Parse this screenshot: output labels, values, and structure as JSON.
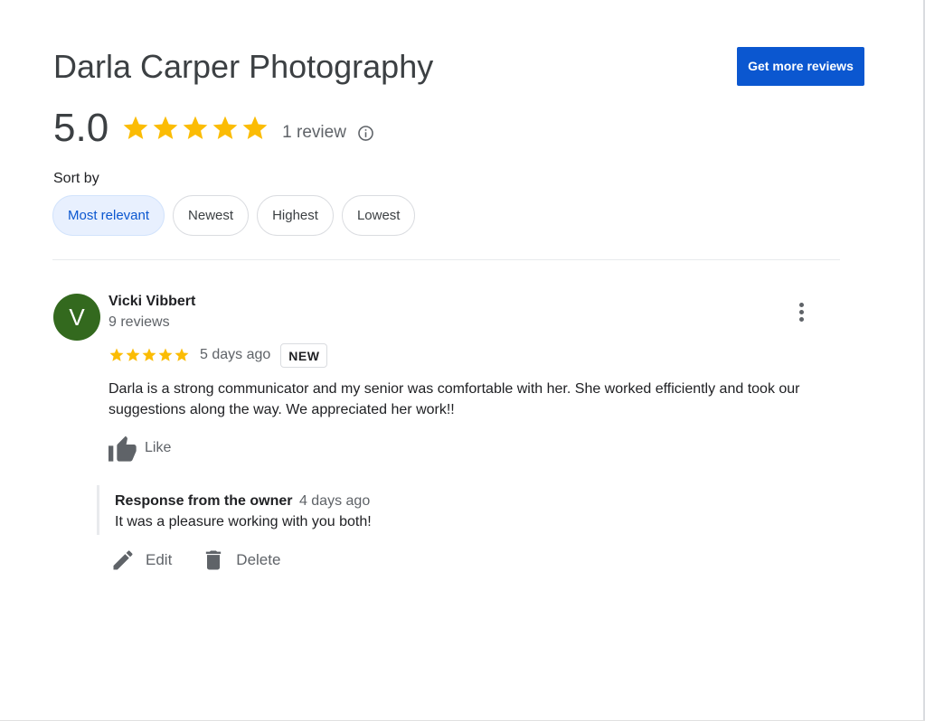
{
  "header": {
    "title": "Darla Carper Photography",
    "cta_label": "Get more reviews"
  },
  "summary": {
    "rating": "5.0",
    "stars": 5,
    "review_count_label": "1 review",
    "info_icon": "info-icon"
  },
  "sort": {
    "label": "Sort by",
    "options": [
      "Most relevant",
      "Newest",
      "Highest",
      "Lowest"
    ],
    "selected": "Most relevant"
  },
  "review": {
    "avatar_initial": "V",
    "avatar_color": "#33691e",
    "reviewer_name": "Vicki Vibbert",
    "reviewer_review_count": "9 reviews",
    "stars": 5,
    "date": "5 days ago",
    "badge": "NEW",
    "text": "Darla is a strong communicator and my senior was comfortable with her.  She worked efficiently and took our suggestions along the way. We appreciated her work!!",
    "like_label": "Like",
    "owner_response": {
      "label": "Response from the owner",
      "date": "4 days ago",
      "text": "It was a pleasure working with you both!"
    },
    "actions": {
      "edit_label": "Edit",
      "delete_label": "Delete"
    }
  },
  "colors": {
    "accent": "#0b57d0",
    "star": "#fbbc04",
    "chip_selected_bg": "#e8f0fe",
    "muted_text": "#5f6368"
  }
}
